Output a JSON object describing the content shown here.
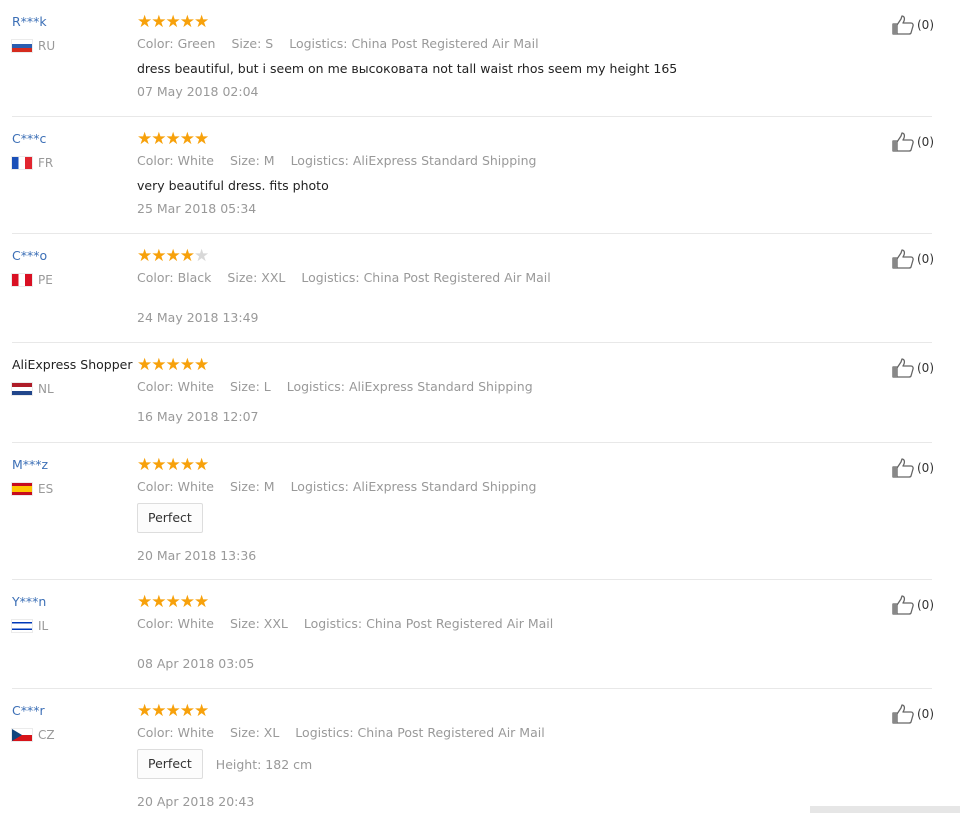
{
  "reviews": [
    {
      "user": "R***k",
      "country": "RU",
      "stars": 5,
      "color": "Color: Green",
      "size": "Size: S",
      "logistics": "Logistics: China Post Registered Air Mail",
      "text": "dress beautiful, but i seem on me высоковата not tall waist rhos seem my height 165",
      "date": "07 May 2018 02:04",
      "helpful": "(0)"
    },
    {
      "user": "C***c",
      "country": "FR",
      "stars": 5,
      "color": "Color: White",
      "size": "Size: M",
      "logistics": "Logistics: AliExpress Standard Shipping",
      "text": "very beautiful dress. fits photo",
      "date": "25 Mar 2018 05:34",
      "helpful": "(0)"
    },
    {
      "user": "C***o",
      "country": "PE",
      "stars": 4,
      "color": "Color: Black",
      "size": "Size: XXL",
      "logistics": "Logistics: China Post Registered Air Mail",
      "date": "24 May 2018 13:49",
      "helpful": "(0)"
    },
    {
      "user": "AliExpress Shopper",
      "country": "NL",
      "stars": 5,
      "color": "Color: White",
      "size": "Size: L",
      "logistics": "Logistics: AliExpress Standard Shipping",
      "date": "16 May 2018 12:07",
      "helpful": "(0)"
    },
    {
      "user": "M***z",
      "country": "ES",
      "stars": 5,
      "color": "Color: White",
      "size": "Size: M",
      "logistics": "Logistics: AliExpress Standard Shipping",
      "tag": "Perfect",
      "date": "20 Mar 2018 13:36",
      "helpful": "(0)"
    },
    {
      "user": "Y***n",
      "country": "IL",
      "stars": 5,
      "color": "Color: White",
      "size": "Size: XXL",
      "logistics": "Logistics: China Post Registered Air Mail",
      "date": "08 Apr 2018 03:05",
      "helpful": "(0)"
    },
    {
      "user": "C***r",
      "country": "CZ",
      "stars": 5,
      "color": "Color: White",
      "size": "Size: XL",
      "logistics": "Logistics: China Post Registered Air Mail",
      "tag": "Perfect",
      "height": "Height: 182 cm",
      "date": "20 Apr 2018 20:43",
      "helpful": "(0)"
    }
  ],
  "colors": {
    "star_on": "#f7a10b",
    "star_off": "#d8d8d8",
    "username": "#3c6fb6",
    "meta": "#999999"
  },
  "icons": {
    "star": "star-icon",
    "thumb": "thumbs-up-icon"
  }
}
